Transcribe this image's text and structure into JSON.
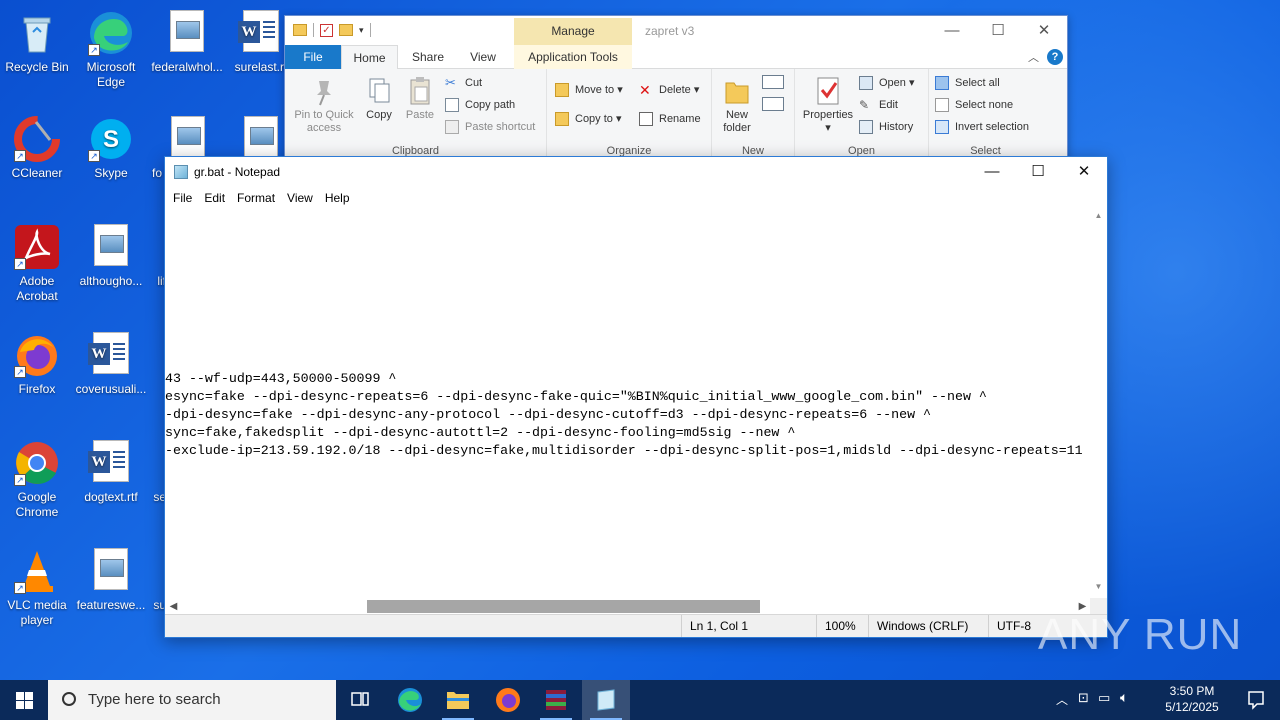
{
  "desktop": {
    "icons": [
      {
        "label": "Recycle Bin"
      },
      {
        "label": "Microsoft Edge"
      },
      {
        "label": "federalwhol..."
      },
      {
        "label": "surelast.rt"
      },
      {
        "label": "CCleaner"
      },
      {
        "label": "Skype"
      },
      {
        "label": "fo"
      },
      {
        "label": "Adobe Acrobat"
      },
      {
        "label": "althougho..."
      },
      {
        "label": "lif"
      },
      {
        "label": "Firefox"
      },
      {
        "label": "coverusuali..."
      },
      {
        "label": "Google Chrome"
      },
      {
        "label": "dogtext.rtf"
      },
      {
        "label": "se"
      },
      {
        "label": "VLC media player"
      },
      {
        "label": "featureswe..."
      },
      {
        "label": "su"
      }
    ]
  },
  "explorer": {
    "title": "zapret v3",
    "manage_tab": "Manage",
    "tabs": {
      "file": "File",
      "home": "Home",
      "share": "Share",
      "view": "View",
      "app_tools": "Application Tools"
    },
    "clipboard": {
      "label": "Clipboard",
      "pin": "Pin to Quick access",
      "copy": "Copy",
      "paste": "Paste",
      "cut": "Cut",
      "copy_path": "Copy path",
      "paste_shortcut": "Paste shortcut"
    },
    "organize": {
      "label": "Organize",
      "move_to": "Move to",
      "copy_to": "Copy to",
      "delete": "Delete",
      "rename": "Rename"
    },
    "new": {
      "label": "New",
      "new_folder": "New folder"
    },
    "open": {
      "label": "Open",
      "properties": "Properties",
      "open": "Open",
      "edit": "Edit",
      "history": "History"
    },
    "select": {
      "label": "Select",
      "select_all": "Select all",
      "select_none": "Select none",
      "invert": "Invert selection"
    }
  },
  "notepad": {
    "title": "gr.bat - Notepad",
    "menu": {
      "file": "File",
      "edit": "Edit",
      "format": "Format",
      "view": "View",
      "help": "Help"
    },
    "lines": [
      "43 --wf-udp=443,50000-50099 ^",
      "esync=fake --dpi-desync-repeats=6 --dpi-desync-fake-quic=\"%BIN%quic_initial_www_google_com.bin\" --new ^",
      "-dpi-desync=fake --dpi-desync-any-protocol --dpi-desync-cutoff=d3 --dpi-desync-repeats=6 --new ^",
      "sync=fake,fakedsplit --dpi-desync-autottl=2 --dpi-desync-fooling=md5sig --new ^",
      "-exclude-ip=213.59.192.0/18 --dpi-desync=fake,multidisorder --dpi-desync-split-pos=1,midsld --dpi-desync-repeats=11"
    ],
    "status": {
      "position": "Ln 1, Col 1",
      "zoom": "100%",
      "eol": "Windows (CRLF)",
      "encoding": "UTF-8"
    }
  },
  "taskbar": {
    "search_placeholder": "Type here to search",
    "time": "3:50 PM",
    "date": "5/12/2025"
  },
  "watermark": "ANY RUN"
}
